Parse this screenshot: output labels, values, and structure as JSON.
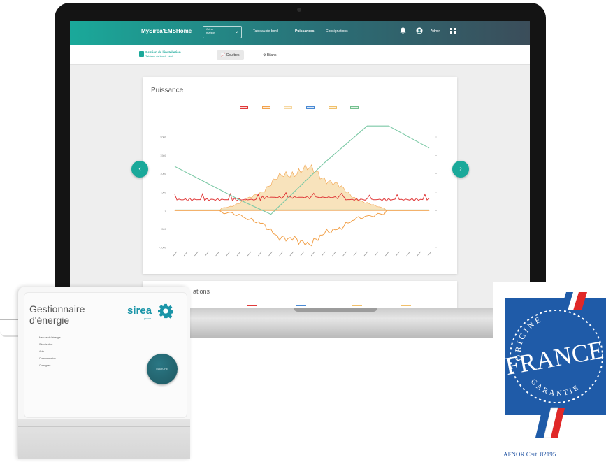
{
  "app": {
    "brand": "MySirea'EMSHome",
    "site_select": {
      "line1": "Gérer",
      "line2": "maison",
      "chevron": "⌄"
    },
    "nav": [
      {
        "label": "Tableau de bord"
      },
      {
        "label": "Puissances",
        "active": true
      },
      {
        "label": "Consignations"
      }
    ],
    "icons": [
      "bell-icon",
      "user-icon",
      "grid-icon"
    ],
    "user_label": "Admin",
    "installation": {
      "title": "Gestion de l'installation",
      "subtitle": "Tableau de bord - réel"
    },
    "subtabs": [
      {
        "label": "Courbes",
        "icon": "chart-icon",
        "active": true
      },
      {
        "label": "Bilans",
        "icon": "gear-icon",
        "active": false
      }
    ],
    "colors": {
      "teal": "#1aa99a",
      "dark_teal": "#2a6f76"
    }
  },
  "chart_card": {
    "title": "Puissance",
    "second_title": "ations"
  },
  "chart_data": {
    "type": "line",
    "title": "Puissance",
    "series": [
      {
        "color": "#e03a3a"
      },
      {
        "color": "#f2a24c"
      },
      {
        "color": "#f6d7a0"
      },
      {
        "color": "#4a8ad4"
      },
      {
        "color": "#f0c06a"
      },
      {
        "color": "#74c08e"
      }
    ],
    "legend_placement": "top",
    "y_axis_left_ticks": [
      "2000",
      "1500",
      "1000",
      "500",
      "0",
      "-500",
      "-1000"
    ],
    "shape_notes": {
      "red_baseline_level": 300,
      "orange_dip_min": -1000,
      "solar_peak": 1300,
      "green_peak_right_axis": 100
    },
    "x_ticks": 25,
    "grid": false
  },
  "carousel": {
    "prev": "‹",
    "next": "›"
  },
  "device": {
    "title": "Gestionnaire\nd'énergie",
    "logo": "sirea",
    "logo_sub": "group",
    "menu": [
      "Mesure de l'énergie",
      "Sécurisation",
      "Auto",
      "Consommation",
      "Consignes"
    ],
    "button_label": "MARCHE"
  },
  "badge": {
    "top_text": "ORIGINE",
    "main_text": "FRANCE",
    "bottom_text": "GARANTIE",
    "certification": "AFNOR Cert. 82195",
    "colors": {
      "blue": "#1f5ba8",
      "red": "#e02828"
    }
  }
}
